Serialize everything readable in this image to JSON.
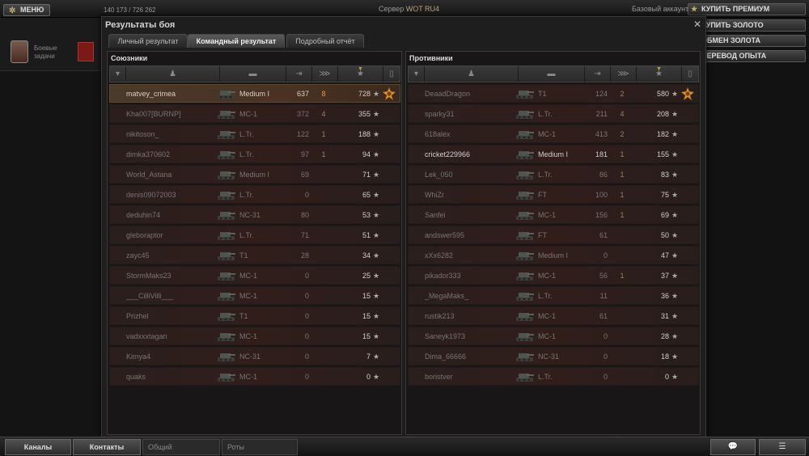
{
  "topbar": {
    "menu_label": "МЕНЮ",
    "resources": "140 173 / 726 262",
    "server_prefix": "Сервер",
    "server_name": "WOT RU4",
    "account_type": "Базовый аккаунт",
    "buttons": [
      "КУПИТЬ ПРЕМИУМ",
      "КУПИТЬ ЗОЛОТО",
      "ОБМЕН ЗОЛОТА",
      "ПЕРЕВОД ОПЫТА"
    ]
  },
  "hangar": {
    "quests_label": "Боевые задачи"
  },
  "dialog": {
    "title": "Результаты боя",
    "tabs": [
      "Личный результат",
      "Командный результат",
      "Подробный отчёт"
    ],
    "active_tab": 1
  },
  "allies": {
    "title": "Союзники",
    "rows": [
      {
        "name": "matvey_crimea",
        "tank": "Medium I",
        "damage": "637",
        "frags": "8",
        "xp": "728",
        "medal": true,
        "style": "me"
      },
      {
        "name": "Kha007[BURNP]",
        "tank": "MC-1",
        "damage": "372",
        "frags": "4",
        "xp": "355"
      },
      {
        "name": "nikitoson_",
        "tank": "L.Tr.",
        "damage": "122",
        "frags": "1",
        "xp": "188"
      },
      {
        "name": "dimka370602",
        "tank": "L.Tr.",
        "damage": "97",
        "frags": "1",
        "xp": "94"
      },
      {
        "name": "World_Astana",
        "tank": "Medium I",
        "damage": "69",
        "frags": "",
        "xp": "71"
      },
      {
        "name": "denis09072003",
        "tank": "L.Tr.",
        "damage": "0",
        "frags": "",
        "xp": "65"
      },
      {
        "name": "deduhin74",
        "tank": "NC-31",
        "damage": "80",
        "frags": "",
        "xp": "53"
      },
      {
        "name": "gleboraptor",
        "tank": "L.Tr.",
        "damage": "71",
        "frags": "",
        "xp": "51"
      },
      {
        "name": "zayc45",
        "tank": "T1",
        "damage": "28",
        "frags": "",
        "xp": "34"
      },
      {
        "name": "StormMaks23",
        "tank": "MC-1",
        "damage": "0",
        "frags": "",
        "xp": "25"
      },
      {
        "name": "___CilliVilli___",
        "tank": "MC-1",
        "damage": "0",
        "frags": "",
        "xp": "15"
      },
      {
        "name": "Prizhel",
        "tank": "T1",
        "damage": "0",
        "frags": "",
        "xp": "15"
      },
      {
        "name": "vadxxxtagan",
        "tank": "MC-1",
        "damage": "0",
        "frags": "",
        "xp": "15"
      },
      {
        "name": "Kimya4",
        "tank": "NC-31",
        "damage": "0",
        "frags": "",
        "xp": "7"
      },
      {
        "name": "quaks",
        "tank": "MC-1",
        "damage": "0",
        "frags": "",
        "xp": "0"
      }
    ]
  },
  "enemies": {
    "title": "Противники",
    "rows": [
      {
        "name": "DeaadDragon",
        "tank": "T1",
        "damage": "124",
        "frags": "2",
        "xp": "580",
        "medal": true
      },
      {
        "name": "sparky31",
        "tank": "L.Tr.",
        "damage": "211",
        "frags": "4",
        "xp": "208"
      },
      {
        "name": "618alex",
        "tank": "MC-1",
        "damage": "413",
        "frags": "2",
        "xp": "182"
      },
      {
        "name": "cricket229966",
        "tank": "Medium I",
        "damage": "181",
        "frags": "1",
        "xp": "155",
        "style": "hi"
      },
      {
        "name": "Lek_050",
        "tank": "L.Tr.",
        "damage": "86",
        "frags": "1",
        "xp": "83"
      },
      {
        "name": "WhiZr",
        "tank": "FT",
        "damage": "100",
        "frags": "1",
        "xp": "75"
      },
      {
        "name": "Sanfei",
        "tank": "MC-1",
        "damage": "156",
        "frags": "1",
        "xp": "69"
      },
      {
        "name": "andswer595",
        "tank": "FT",
        "damage": "61",
        "frags": "",
        "xp": "50"
      },
      {
        "name": "xXx6282",
        "tank": "Medium I",
        "damage": "0",
        "frags": "",
        "xp": "47"
      },
      {
        "name": "pikador333",
        "tank": "MC-1",
        "damage": "56",
        "frags": "1",
        "xp": "37"
      },
      {
        "name": "_MegaMaks_",
        "tank": "L.Tr.",
        "damage": "11",
        "frags": "",
        "xp": "36"
      },
      {
        "name": "rustik213",
        "tank": "MC-1",
        "damage": "61",
        "frags": "",
        "xp": "31"
      },
      {
        "name": "Saneyk1973",
        "tank": "MC-1",
        "damage": "0",
        "frags": "",
        "xp": "28"
      },
      {
        "name": "Dima_66666",
        "tank": "NC-31",
        "damage": "0",
        "frags": "",
        "xp": "18"
      },
      {
        "name": "boristver",
        "tank": "L.Tr.",
        "damage": "0",
        "frags": "",
        "xp": "0"
      }
    ]
  },
  "bottombar": {
    "channels_label": "Каналы",
    "contacts_label": "Контакты",
    "field_general": "Общий",
    "field_platoons": "Роты"
  },
  "colors": {
    "accent": "#c8a040",
    "row_bg": "#2a1f1d",
    "row_me_bg": "#4a3a2a"
  }
}
